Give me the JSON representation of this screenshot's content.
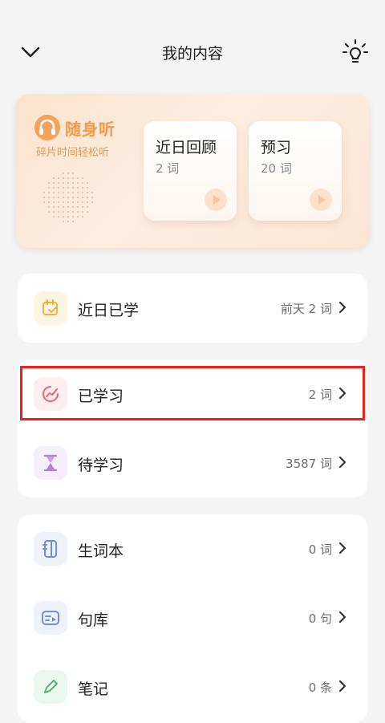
{
  "header": {
    "title": "我的内容"
  },
  "audio_card": {
    "brand_name": "随身听",
    "slogan": "碎片时间轻松听",
    "cards": [
      {
        "title": "近日回顾",
        "count": "2 词"
      },
      {
        "title": "预习",
        "count": "20 词"
      }
    ]
  },
  "group1": {
    "items": [
      {
        "label": "近日已学",
        "value": "前天 2 词"
      }
    ]
  },
  "group2": {
    "items": [
      {
        "label": "已学习",
        "value": "2 词"
      },
      {
        "label": "待学习",
        "value": "3587 词"
      }
    ]
  },
  "group3": {
    "items": [
      {
        "label": "生词本",
        "value": "0 词"
      },
      {
        "label": "句库",
        "value": "0 句"
      },
      {
        "label": "笔记",
        "value": "0 条"
      }
    ]
  },
  "colors": {
    "highlight": "#e8231a",
    "brand": "#f29a4a",
    "icon_recent": "#f0b43a",
    "icon_learned": "#e8707a",
    "icon_pending": "#b47fd6",
    "icon_notebook": "#6f8fe6",
    "icon_sentence": "#6f8fe6",
    "icon_note": "#4fb879"
  },
  "icons": {
    "back": "chevron-down-icon",
    "tip": "lightbulb-icon",
    "brand": "headphones-icon",
    "recent": "calendar-check-icon",
    "learned": "trend-chart-icon",
    "pending": "hourglass-icon",
    "notebook": "notebook-icon",
    "sentence": "video-card-icon",
    "note": "pen-icon",
    "play": "play-icon"
  }
}
